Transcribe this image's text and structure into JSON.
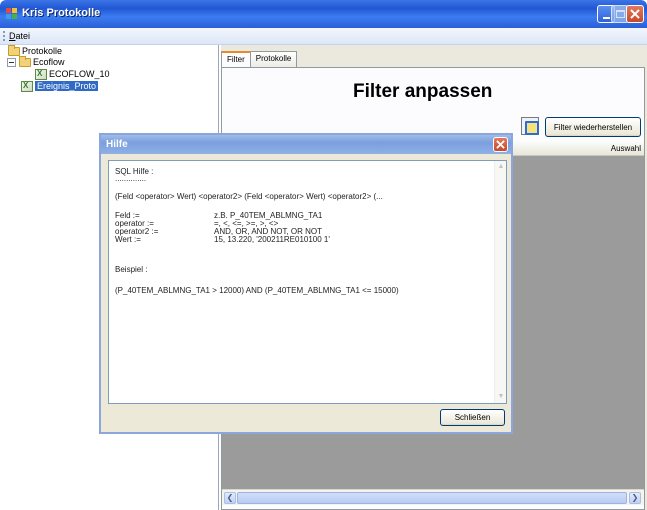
{
  "window": {
    "title": "Kris Protokolle"
  },
  "menu": {
    "items": [
      "Datei"
    ]
  },
  "tree": {
    "root": "Protokolle",
    "folder": "Ecoflow",
    "file": "ECOFLOW_10",
    "selected": "Ereignis_Proto"
  },
  "tabs": [
    "Filter",
    "Protokolle"
  ],
  "filter": {
    "heading": "Filter anpassen",
    "restore_button": "Filter wiederherstellen",
    "column_header": "Auswahl"
  },
  "dialog": {
    "title": "Hilfe",
    "lines": {
      "header": "SQL Hilfe :",
      "underline": "..............",
      "syntax": "(Feld <operator> Wert) <operator2> (Feld <operator> Wert) <operator2> (...",
      "defs": [
        {
          "key": "Feld :=",
          "value": "z.B. P_40TEM_ABLMNG_TA1"
        },
        {
          "key": "operator :=",
          "value": "=, <, <=, >=, >, <>"
        },
        {
          "key": "operator2 :=",
          "value": "AND, OR, AND NOT, OR NOT"
        },
        {
          "key": "Wert :=",
          "value": "15, 13.220, '200211RE010100 1'"
        }
      ],
      "example_label": "Beispiel :",
      "example": "(P_40TEM_ABLMNG_TA1 > 12000) AND (P_40TEM_ABLMNG_TA1 <= 15000)"
    },
    "close_button": "Schließen"
  },
  "colors": {
    "titlebar": "#2157d4",
    "selection": "#316ac5",
    "tab_accent": "#e68b2c",
    "grid_background": "#9b9b9b"
  }
}
